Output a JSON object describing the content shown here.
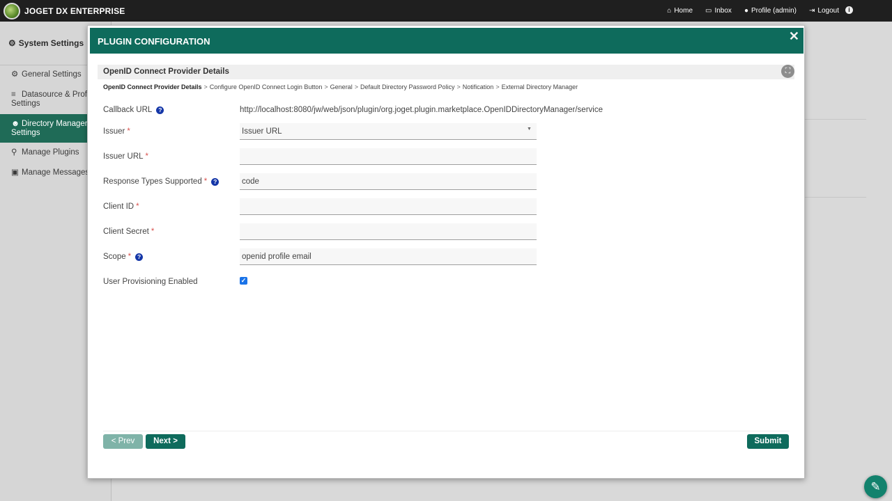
{
  "app": {
    "brand": "JOGET DX ENTERPRISE"
  },
  "topnav": {
    "home": "Home",
    "inbox": "Inbox",
    "profile": "Profile (admin)",
    "logout": "Logout"
  },
  "sidebar": {
    "title": "System Settings",
    "items": [
      {
        "label": "General Settings",
        "icon": "gear-icon"
      },
      {
        "label": "Datasource & Profile Settings",
        "icon": "database-icon"
      },
      {
        "label": "Directory Manager Settings",
        "icon": "users-icon",
        "active": true
      },
      {
        "label": "Manage Plugins",
        "icon": "plug-icon"
      },
      {
        "label": "Manage Messages",
        "icon": "language-icon"
      }
    ]
  },
  "modal": {
    "title": "PLUGIN CONFIGURATION",
    "section_title": "OpenID Connect Provider Details",
    "breadcrumbs": [
      "OpenID Connect Provider Details",
      "Configure OpenID Connect Login Button",
      "General",
      "Default Directory Password Policy",
      "Notification",
      "External Directory Manager"
    ],
    "fields": {
      "callback_url": {
        "label": "Callback URL",
        "value": "http://localhost:8080/jw/web/json/plugin/org.joget.plugin.marketplace.OpenIDDirectoryManager/service"
      },
      "issuer": {
        "label": "Issuer",
        "value": "Issuer URL"
      },
      "issuer_url": {
        "label": "Issuer URL",
        "value": ""
      },
      "response_types": {
        "label": "Response Types Supported",
        "value": "code"
      },
      "client_id": {
        "label": "Client ID",
        "value": ""
      },
      "client_secret": {
        "label": "Client Secret",
        "value": ""
      },
      "scope": {
        "label": "Scope",
        "value": "openid profile email"
      },
      "user_provisioning": {
        "label": "User Provisioning Enabled",
        "checked": true
      }
    },
    "buttons": {
      "prev": "< Prev",
      "next": "Next >",
      "submit": "Submit"
    }
  },
  "colors": {
    "header": "#0e6b5c",
    "active_sidebar": "#1f6b57",
    "required": "#d9534f"
  }
}
